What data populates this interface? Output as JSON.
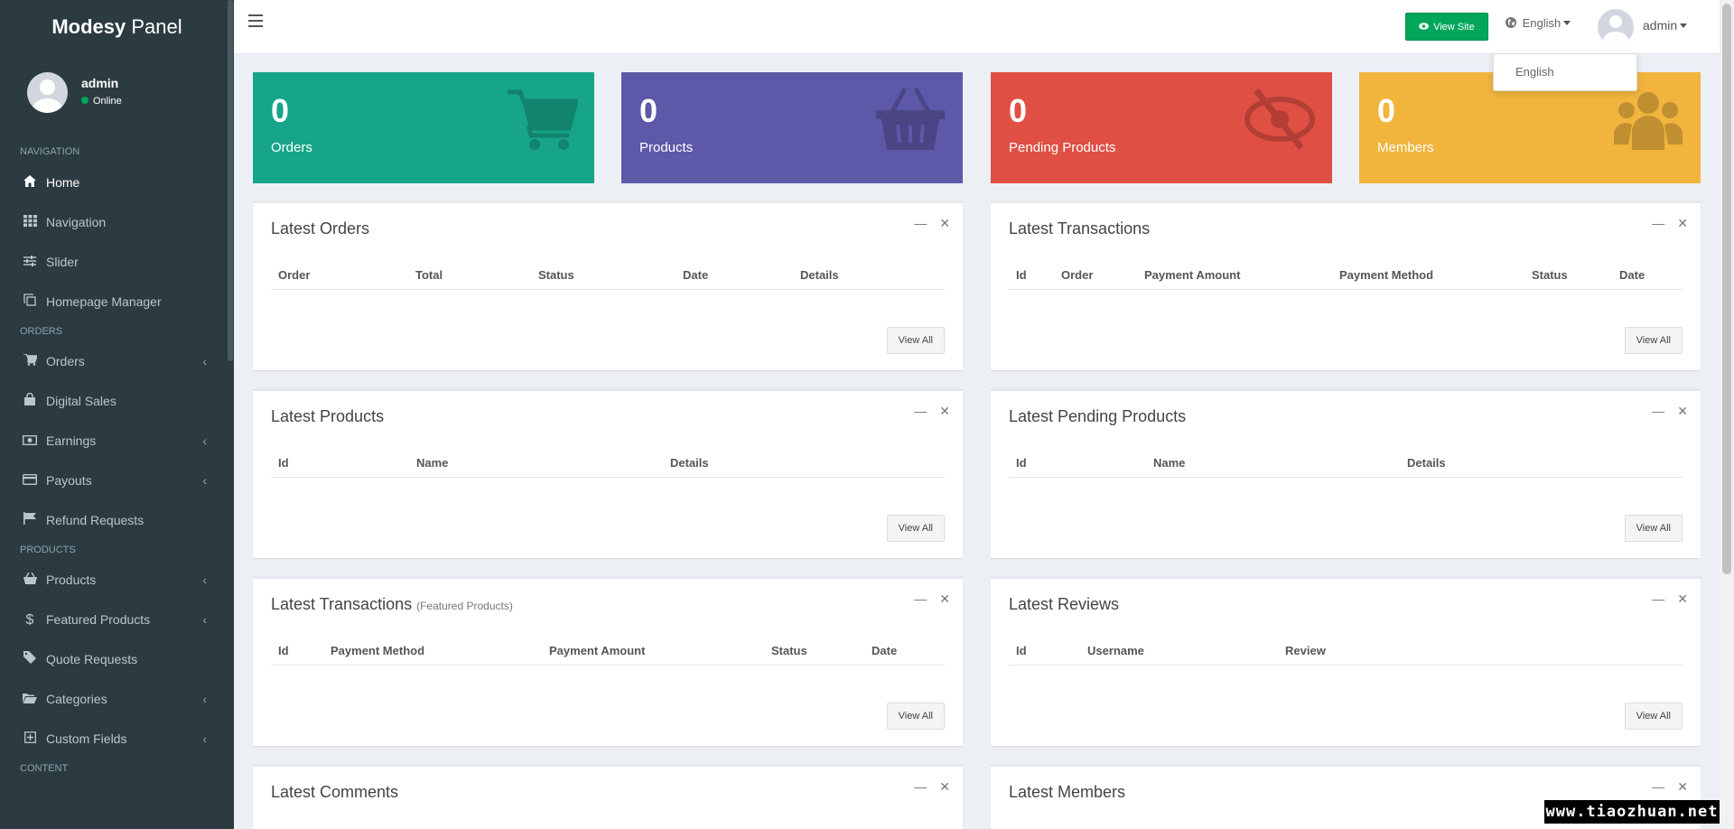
{
  "brand": {
    "bold": "Modesy",
    "rest": " Panel"
  },
  "user": {
    "name": "admin",
    "status": "Online"
  },
  "sidebar": {
    "sections": [
      "Navigation",
      "Orders",
      "Products",
      "Content"
    ],
    "items": [
      {
        "label": "Home",
        "icon": "home-icon"
      },
      {
        "label": "Navigation",
        "icon": "grid-icon"
      },
      {
        "label": "Slider",
        "icon": "sliders-icon"
      },
      {
        "label": "Homepage Manager",
        "icon": "copy-icon"
      },
      {
        "label": "Orders",
        "icon": "cart-icon"
      },
      {
        "label": "Digital Sales",
        "icon": "shopping-bag-icon"
      },
      {
        "label": "Earnings",
        "icon": "money-icon"
      },
      {
        "label": "Payouts",
        "icon": "credit-card-icon"
      },
      {
        "label": "Refund Requests",
        "icon": "flag-icon"
      },
      {
        "label": "Products",
        "icon": "shopping-basket-icon"
      },
      {
        "label": "Featured Products",
        "icon": "dollar-icon"
      },
      {
        "label": "Quote Requests",
        "icon": "tag-icon"
      },
      {
        "label": "Categories",
        "icon": "folder-open-icon"
      },
      {
        "label": "Custom Fields",
        "icon": "plus-square-icon"
      }
    ]
  },
  "header": {
    "view_site": "View Site",
    "language": "English",
    "admin": "admin"
  },
  "lang_dropdown": [
    "English"
  ],
  "stats": [
    {
      "value": "0",
      "label": "Orders",
      "color": "#17a589"
    },
    {
      "value": "0",
      "label": "Products",
      "color": "#5d58a8"
    },
    {
      "value": "0",
      "label": "Pending Products",
      "color": "#e04f44"
    },
    {
      "value": "0",
      "label": "Members",
      "color": "#f1b43d"
    }
  ],
  "panels": {
    "latest_orders": {
      "title": "Latest Orders",
      "cols": [
        "Order",
        "Total",
        "Status",
        "Date",
        "Details"
      ]
    },
    "latest_transactions": {
      "title": "Latest Transactions",
      "cols": [
        "Id",
        "Order",
        "Payment Amount",
        "Payment Method",
        "Status",
        "Date"
      ]
    },
    "latest_products": {
      "title": "Latest Products",
      "cols": [
        "Id",
        "Name",
        "Details"
      ]
    },
    "latest_pending_products": {
      "title": "Latest Pending Products",
      "cols": [
        "Id",
        "Name",
        "Details"
      ]
    },
    "latest_featured_transactions": {
      "title": "Latest Transactions",
      "subtitle": "(Featured Products)",
      "cols": [
        "Id",
        "Payment Method",
        "Payment Amount",
        "Status",
        "Date"
      ]
    },
    "latest_reviews": {
      "title": "Latest Reviews",
      "cols": [
        "Id",
        "Username",
        "Review"
      ]
    },
    "latest_comments": {
      "title": "Latest Comments"
    },
    "latest_members": {
      "title": "Latest Members"
    }
  },
  "view_all": "View All",
  "watermark": "www.tiaozhuan.net"
}
